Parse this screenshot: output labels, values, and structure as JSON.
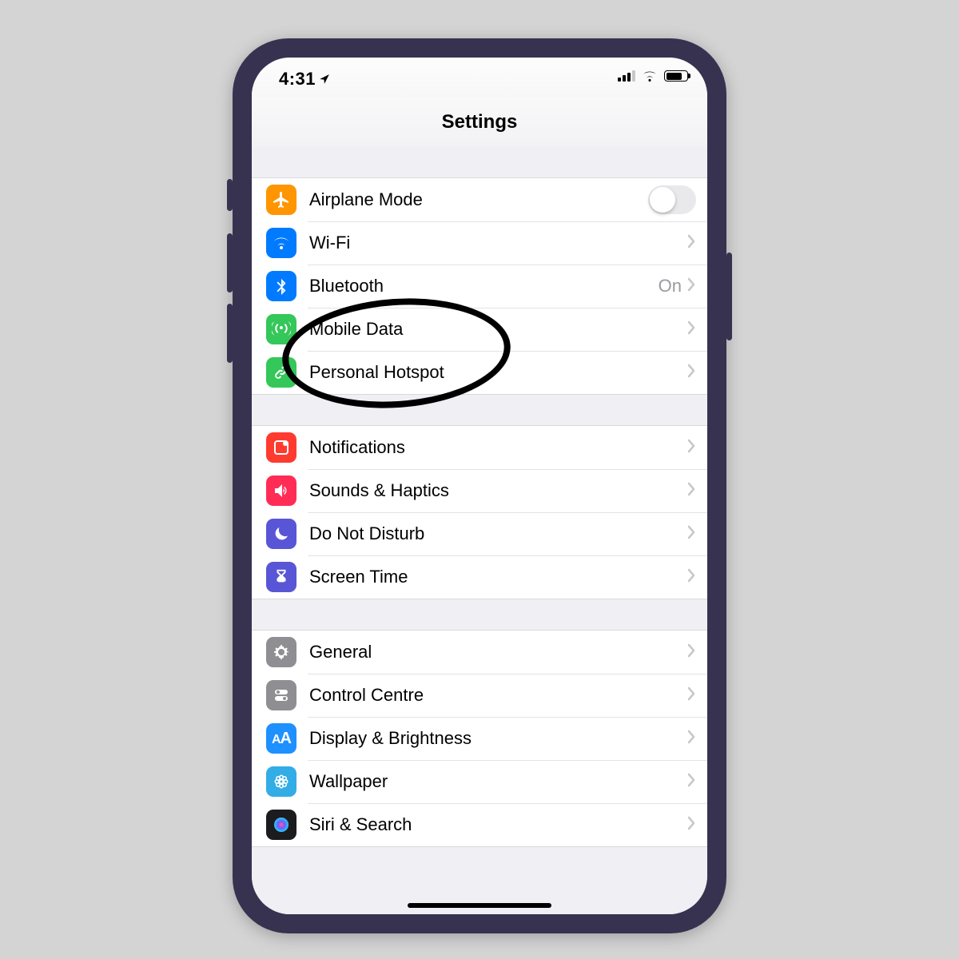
{
  "statusbar": {
    "time": "4:31"
  },
  "nav": {
    "title": "Settings"
  },
  "groups": [
    {
      "rows": [
        {
          "icon": "airplane",
          "color": "c-orange",
          "label": "Airplane Mode",
          "control": "switch"
        },
        {
          "icon": "wifi",
          "color": "c-blue",
          "label": "Wi-Fi",
          "control": "disclosure"
        },
        {
          "icon": "bluetooth",
          "color": "c-blue",
          "label": "Bluetooth",
          "value": "On",
          "control": "disclosure"
        },
        {
          "icon": "antenna",
          "color": "c-green",
          "label": "Mobile Data",
          "control": "disclosure"
        },
        {
          "icon": "link",
          "color": "c-green",
          "label": "Personal Hotspot",
          "control": "disclosure"
        }
      ]
    },
    {
      "rows": [
        {
          "icon": "notif",
          "color": "c-red",
          "label": "Notifications",
          "control": "disclosure"
        },
        {
          "icon": "speaker",
          "color": "c-pink",
          "label": "Sounds & Haptics",
          "control": "disclosure"
        },
        {
          "icon": "moon",
          "color": "c-indigo",
          "label": "Do Not Disturb",
          "control": "disclosure"
        },
        {
          "icon": "hourglass",
          "color": "c-indigo",
          "label": "Screen Time",
          "control": "disclosure"
        }
      ]
    },
    {
      "rows": [
        {
          "icon": "gear",
          "color": "c-gray",
          "label": "General",
          "control": "disclosure"
        },
        {
          "icon": "switches",
          "color": "c-gray",
          "label": "Control Centre",
          "control": "disclosure"
        },
        {
          "icon": "aa",
          "color": "c-lblue",
          "label": "Display & Brightness",
          "control": "disclosure"
        },
        {
          "icon": "flower",
          "color": "c-cyan",
          "label": "Wallpaper",
          "control": "disclosure"
        },
        {
          "icon": "siri",
          "color": "c-black",
          "label": "Siri & Search",
          "control": "disclosure"
        }
      ]
    }
  ],
  "annotation": {
    "targetLabel": "Personal Hotspot"
  }
}
